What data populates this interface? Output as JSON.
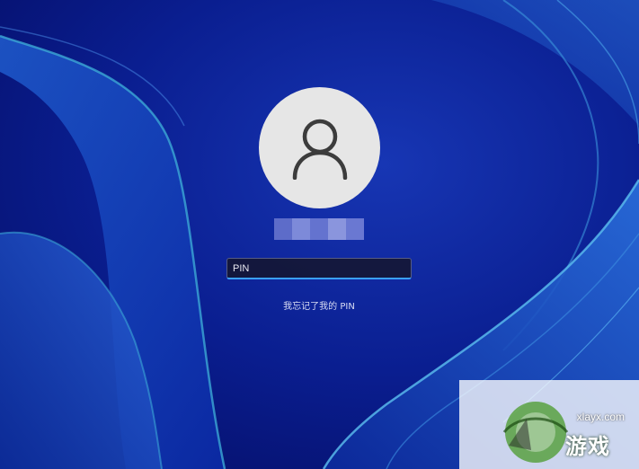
{
  "login": {
    "pin_placeholder": "PIN",
    "pin_value": "",
    "forgot_pin_link": "我忘记了我的 PIN",
    "username_blurred": true
  },
  "icons": {
    "avatar": "user-icon"
  },
  "watermark": {
    "url": "xlayx.com",
    "text": "游戏"
  },
  "colors": {
    "wallpaper_dark": "#07157a",
    "wallpaper_accent": "#2d7fd6",
    "focus_underline": "#3aa0ff",
    "avatar_bg": "#e6e6e6",
    "avatar_icon": "#3c3c3c"
  }
}
